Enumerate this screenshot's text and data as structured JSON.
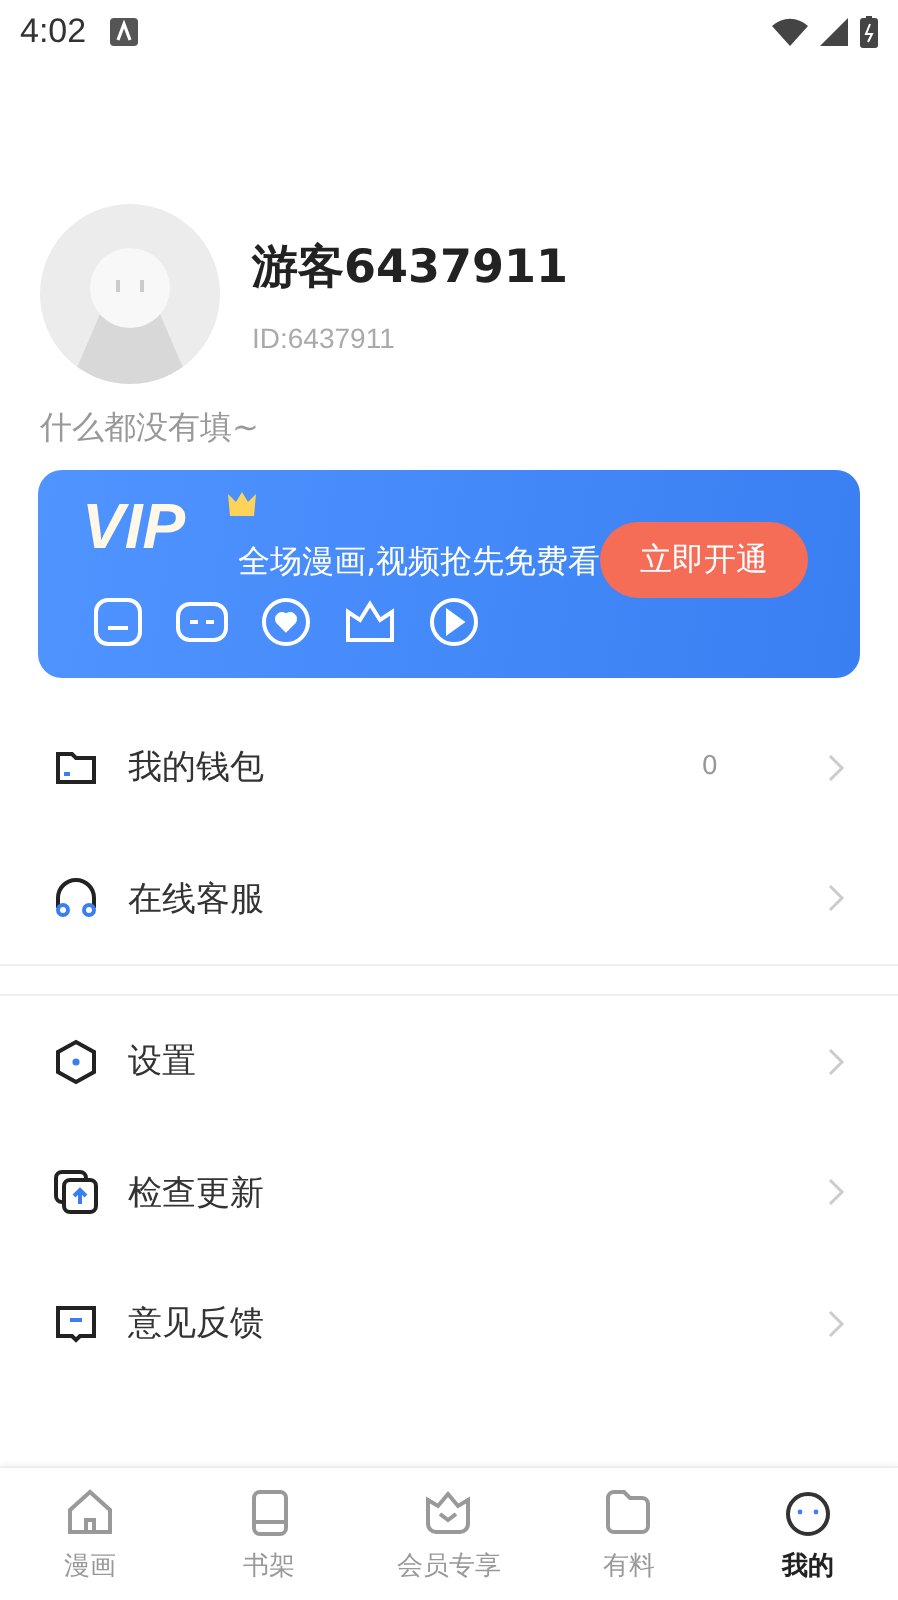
{
  "status_bar": {
    "time": "4:02"
  },
  "profile": {
    "name": "游客6437911",
    "id": "ID:6437911",
    "bio": "什么都没有填~"
  },
  "vip_banner": {
    "title": "VIP",
    "slogan": "全场漫画,视频抢先免费看",
    "button": "立即开通"
  },
  "menu_sections": [
    [
      {
        "label": "我的钱包",
        "value": "0"
      },
      {
        "label": "在线客服"
      }
    ],
    [
      {
        "label": "设置"
      },
      {
        "label": "检查更新"
      },
      {
        "label": "意见反馈"
      }
    ]
  ],
  "tab_bar": [
    {
      "label": "漫画",
      "selected": false
    },
    {
      "label": "书架",
      "selected": false
    },
    {
      "label": "会员专享",
      "selected": false
    },
    {
      "label": "有料",
      "selected": false
    },
    {
      "label": "我的",
      "selected": true
    }
  ]
}
